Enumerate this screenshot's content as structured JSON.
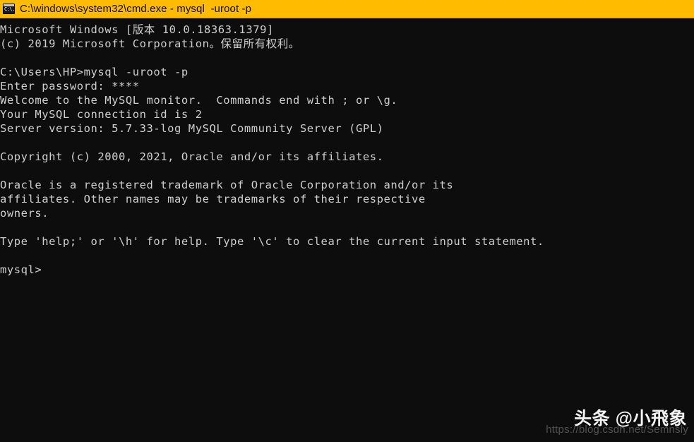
{
  "window": {
    "title": "C:\\windows\\system32\\cmd.exe - mysql  -uroot -p",
    "icon": "cmd-console-icon",
    "icon_glyph": "C:\\.",
    "titlebar_color": "#ffbb00",
    "titlebar_text_color": "#0a0a0a",
    "background_color": "#0d0d0d",
    "foreground_color": "#cfcfcf"
  },
  "console": {
    "lines": [
      "Microsoft Windows [版本 10.0.18363.1379]",
      "(c) 2019 Microsoft Corporation。保留所有权利。",
      "",
      "C:\\Users\\HP>mysql -uroot -p",
      "Enter password: ****",
      "Welcome to the MySQL monitor.  Commands end with ; or \\g.",
      "Your MySQL connection id is 2",
      "Server version: 5.7.33-log MySQL Community Server (GPL)",
      "",
      "Copyright (c) 2000, 2021, Oracle and/or its affiliates.",
      "",
      "Oracle is a registered trademark of Oracle Corporation and/or its",
      "affiliates. Other names may be trademarks of their respective",
      "owners.",
      "",
      "Type 'help;' or '\\h' for help. Type '\\c' to clear the current input statement.",
      "",
      "mysql>"
    ]
  },
  "watermark": {
    "brand": "头条 @小飛象",
    "url": "https://blog.csdn.net/Semnsly"
  }
}
